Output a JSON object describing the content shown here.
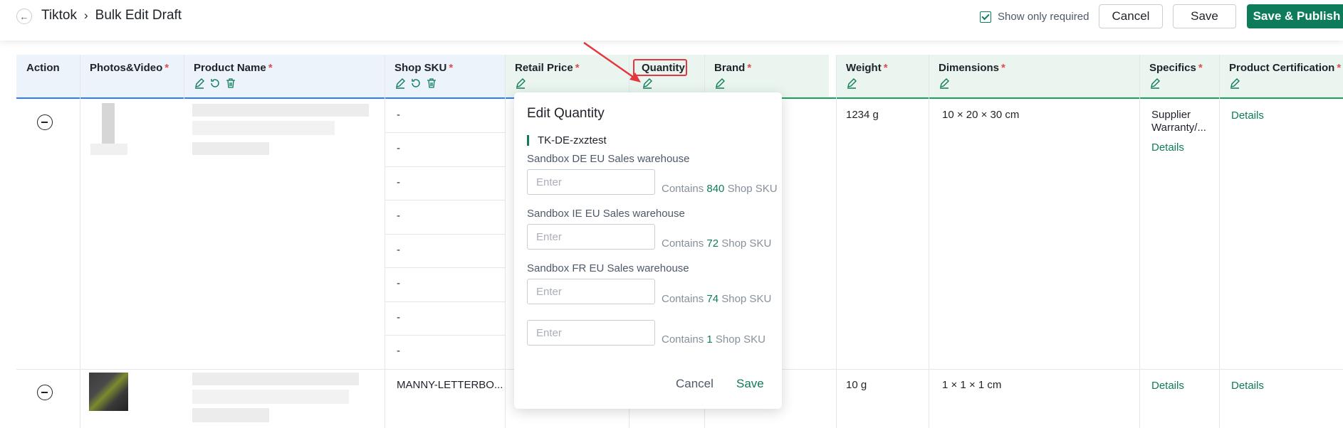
{
  "header": {
    "breadcrumb": [
      "Tiktok",
      "Bulk Edit Draft"
    ],
    "show_only_required": "Show only required",
    "cancel": "Cancel",
    "save": "Save",
    "save_publish": "Save & Publish",
    "accent": "#0e7c5a"
  },
  "columns": {
    "action": "Action",
    "photos": "Photos&Video",
    "product_name": "Product Name",
    "shop_sku": "Shop SKU",
    "retail_price": "Retail Price",
    "quantity": "Quantity",
    "brand": "Brand",
    "weight": "Weight",
    "dimensions": "Dimensions",
    "specifics": "Specifics",
    "certification": "Product Certification",
    "required_mark": "*"
  },
  "rows": [
    {
      "sku_values": [
        "-",
        "-",
        "-",
        "-",
        "-",
        "-",
        "-",
        "-"
      ],
      "weight": "1234 g",
      "dimensions": "10 × 20 × 30 cm",
      "specifics_text": "Supplier Warranty/...",
      "specifics_link": "Details",
      "certification_link": "Details"
    },
    {
      "sku": "MANNY-LETTERBO...",
      "weight": "10 g",
      "dimensions": "1 × 1 × 1 cm",
      "specifics_link": "Details",
      "certification_link": "Details"
    }
  ],
  "popover": {
    "title": "Edit Quantity",
    "shop": "TK-DE-zxztest",
    "warehouses": [
      {
        "label": "Sandbox DE EU Sales warehouse",
        "placeholder": "Enter",
        "contains_prefix": "Contains",
        "count": "840",
        "contains_suffix": "Shop SKU"
      },
      {
        "label": "Sandbox IE EU Sales warehouse",
        "placeholder": "Enter",
        "contains_prefix": "Contains",
        "count": "72",
        "contains_suffix": "Shop SKU"
      },
      {
        "label": "Sandbox FR EU Sales warehouse",
        "placeholder": "Enter",
        "contains_prefix": "Contains",
        "count": "74",
        "contains_suffix": "Shop SKU"
      },
      {
        "label": "",
        "placeholder": "Enter",
        "contains_prefix": "Contains",
        "count": "1",
        "contains_suffix": "Shop SKU"
      }
    ],
    "cancel": "Cancel",
    "save": "Save"
  }
}
